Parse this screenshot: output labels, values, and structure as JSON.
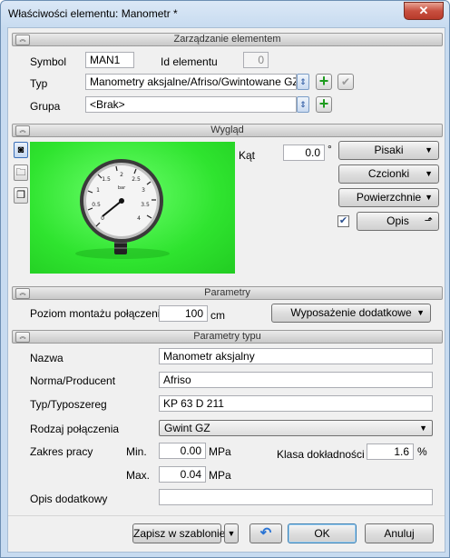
{
  "window": {
    "title": "Właściwości elementu: Manometr *",
    "close": "✕"
  },
  "sections": {
    "management": "Zarządzanie elementem",
    "appearance": "Wygląd",
    "parameters": "Parametry",
    "type_parameters": "Parametry typu"
  },
  "management": {
    "symbol_label": "Symbol",
    "symbol_value": "MAN1",
    "id_label": "Id elementu",
    "id_value": "0",
    "type_label": "Typ",
    "type_value": "Manometry aksjalne/Afriso/Gwintowane GZ/KP",
    "group_label": "Grupa",
    "group_value": "<Brak>"
  },
  "appearance": {
    "angle_label": "Kąt",
    "angle_value": "0.0",
    "angle_unit": "°",
    "pens_button": "Pisaki",
    "fonts_button": "Czcionki",
    "surfaces_button": "Powierzchnie",
    "description_button": "Opis",
    "description_checked": true,
    "gauge_unit_label": "bar"
  },
  "parameters": {
    "mount_label": "Poziom montażu połączenia",
    "mount_value": "100",
    "mount_unit": "cm",
    "extra_equipment_button": "Wyposażenie dodatkowe"
  },
  "type_parameters": {
    "name_label": "Nazwa",
    "name_value": "Manometr aksjalny",
    "norm_label": "Norma/Producent",
    "norm_value": "Afriso",
    "series_label": "Typ/Typoszereg",
    "series_value": "KP 63 D 211",
    "connection_label": "Rodzaj połączenia",
    "connection_value": "Gwint GZ",
    "range_label": "Zakres pracy",
    "min_label": "Min.",
    "min_value": "0.00",
    "max_label": "Max.",
    "max_value": "0.04",
    "pressure_unit": "MPa",
    "accuracy_label": "Klasa dokładności",
    "accuracy_value": "1.6",
    "accuracy_unit": "%",
    "extra_desc_label": "Opis dodatkowy",
    "extra_desc_value": ""
  },
  "footer": {
    "save_template_button": "Zapisz w szablonie",
    "ok_button": "OK",
    "cancel_button": "Anuluj"
  },
  "colors": {
    "preview_background": "#33e633",
    "add_icon": "#1e9b1e",
    "undo_icon": "#2a74d4"
  },
  "icons": [
    "close-icon",
    "chevron-up-icon",
    "spin-arrows-icon",
    "add-icon",
    "check-icon",
    "camera-icon",
    "folder-icon",
    "box-icon",
    "dropdown-arrow-icon",
    "undo-icon",
    "gauge-image"
  ]
}
